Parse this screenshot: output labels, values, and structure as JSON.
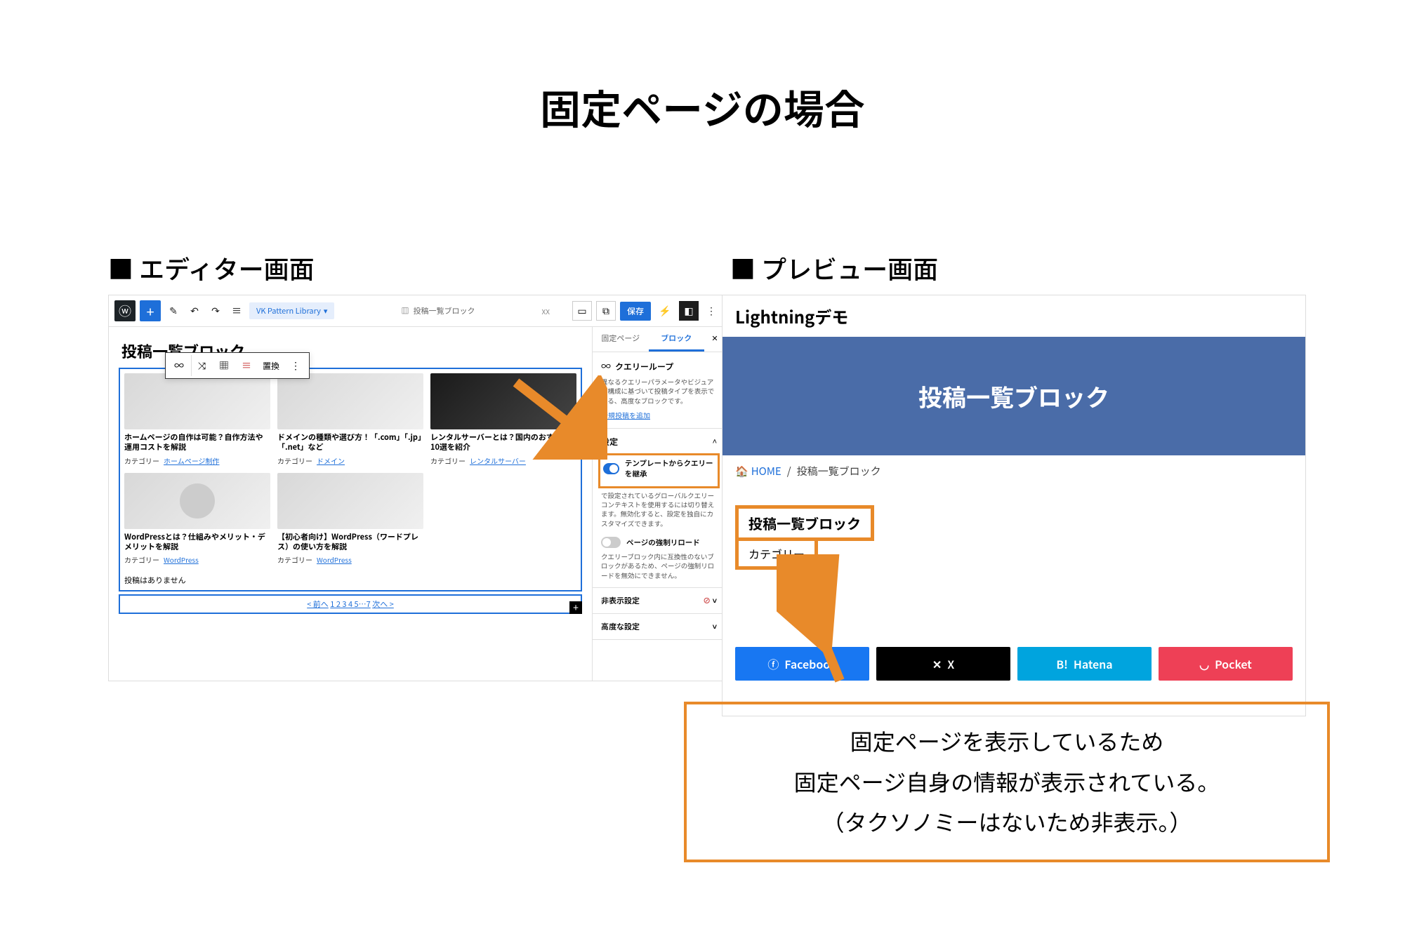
{
  "slide": {
    "title": "固定ページの場合"
  },
  "labels": {
    "editor": "■ エディター画面",
    "preview": "■ プレビュー画面"
  },
  "editor": {
    "breadcrumb": "VK Pattern Library",
    "doc_icon_label": "投稿一覧ブロック",
    "dims": "XX",
    "save": "保存",
    "canvas_title": "投稿一覧ブロック",
    "toolbar_replace": "置換",
    "cards": [
      {
        "title": "ホームページの自作は可能？自作方法や運用コストを解説",
        "cat_label": "カテゴリー",
        "cat_link": "ホームページ制作"
      },
      {
        "title": "ドメインの種類や選び方！「.com」「.jp」「.net」など",
        "cat_label": "カテゴリー",
        "cat_link": "ドメイン"
      },
      {
        "title": "レンタルサーバーとは？国内のおすすめ10選を紹介",
        "cat_label": "カテゴリー",
        "cat_link": "レンタルサーバー"
      },
      {
        "title": "WordPressとは？仕組みやメリット・デメリットを解説",
        "cat_label": "カテゴリー",
        "cat_link": "WordPress"
      },
      {
        "title": "【初心者向け】WordPress（ワードプレス）の使い方を解説",
        "cat_label": "カテゴリー",
        "cat_link": "WordPress"
      }
    ],
    "no_posts": "投稿はありません",
    "pager": {
      "prev": "< 前へ",
      "pages": "1 2 3 4 5…7",
      "next": "次へ >"
    },
    "sidebar": {
      "tabs": {
        "page": "固定ページ",
        "block": "ブロック"
      },
      "query": {
        "title": "クエリーループ",
        "desc": "異なるクエリーパラメータやビジュアル構成に基づいて投稿タイプを表示できる、高度なブロックです。",
        "add_link": "新規投稿を追加"
      },
      "settings_title": "設定",
      "toggle1": {
        "label": "テンプレートからクエリーを継承",
        "desc": "で設定されているグローバルクエリーコンテキストを使用するには切り替えます。無効化すると、設定を独自にカスタマイズできます。"
      },
      "toggle2": {
        "label": "ページの強制リロード",
        "desc": "クエリーブロック内に互換性のないブロックがあるため、ページの強制リロードを無効にできません。"
      },
      "hide_title": "非表示設定",
      "adv_title": "高度な設定"
    }
  },
  "preview": {
    "site_title": "Lightningデモ",
    "hero": "投稿一覧ブロック",
    "breadcrumb_home": "HOME",
    "breadcrumb_page": "投稿一覧ブロック",
    "hl_title": "投稿一覧ブロック",
    "hl_cat": "カテゴリー",
    "share": {
      "fb": "Facebook",
      "x": "X",
      "hatena": "Hatena",
      "pocket": "Pocket"
    }
  },
  "explain": {
    "l1": "固定ページを表示しているため",
    "l2": "固定ページ自身の情報が表示されている。",
    "l3": "（タクソノミーはないため非表示。）"
  }
}
